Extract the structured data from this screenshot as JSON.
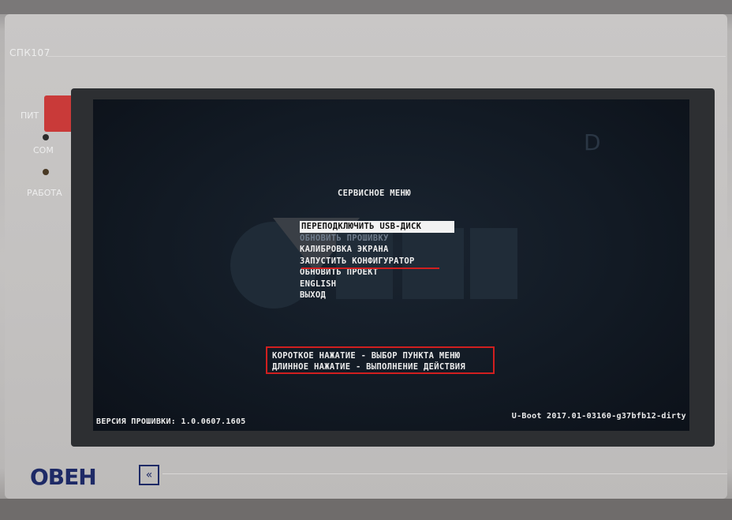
{
  "device": {
    "model": "СПК107",
    "indicators": {
      "power": "ПИТ",
      "com": "COM",
      "work": "РАБОТА"
    },
    "brand": "ОВЕН",
    "brand_chevron": "«"
  },
  "screen": {
    "title": "СЕРВИСНОЕ МЕНЮ",
    "menu": [
      {
        "label": "ПЕРЕПОДКЛЮЧИТЬ USB-ДИСК",
        "selected": true
      },
      {
        "label": "ОБНОВИТЬ ПРОШИВКУ",
        "selected": false
      },
      {
        "label": "КАЛИБРОВКА ЭКРАНА",
        "selected": false
      },
      {
        "label": "ЗАПУСТИТЬ КОНФИГУРАТОР",
        "selected": false
      },
      {
        "label": "ОБНОВИТЬ ПРОЕКТ",
        "selected": false
      },
      {
        "label": "ENGLISH",
        "selected": false
      },
      {
        "label": "ВЫХОД",
        "selected": false
      }
    ],
    "hints": [
      "КОРОТКОЕ НАЖАТИЕ - ВЫБОР ПУНКТА МЕНЮ",
      "ДЛИННОЕ  НАЖАТИЕ - ВЫПОЛНЕНИЕ ДЕЙСТВИЯ"
    ],
    "firmware_version": "ВЕРСИЯ ПРОШИВКИ: 1.0.0607.1605",
    "uboot_version": "U-Boot 2017.01-03160-g37bfb12-dirty"
  },
  "colors": {
    "highlight": "#d11f1f",
    "screen_bg": "#121a24",
    "text": "#ececec",
    "brand": "#1e2a66"
  }
}
